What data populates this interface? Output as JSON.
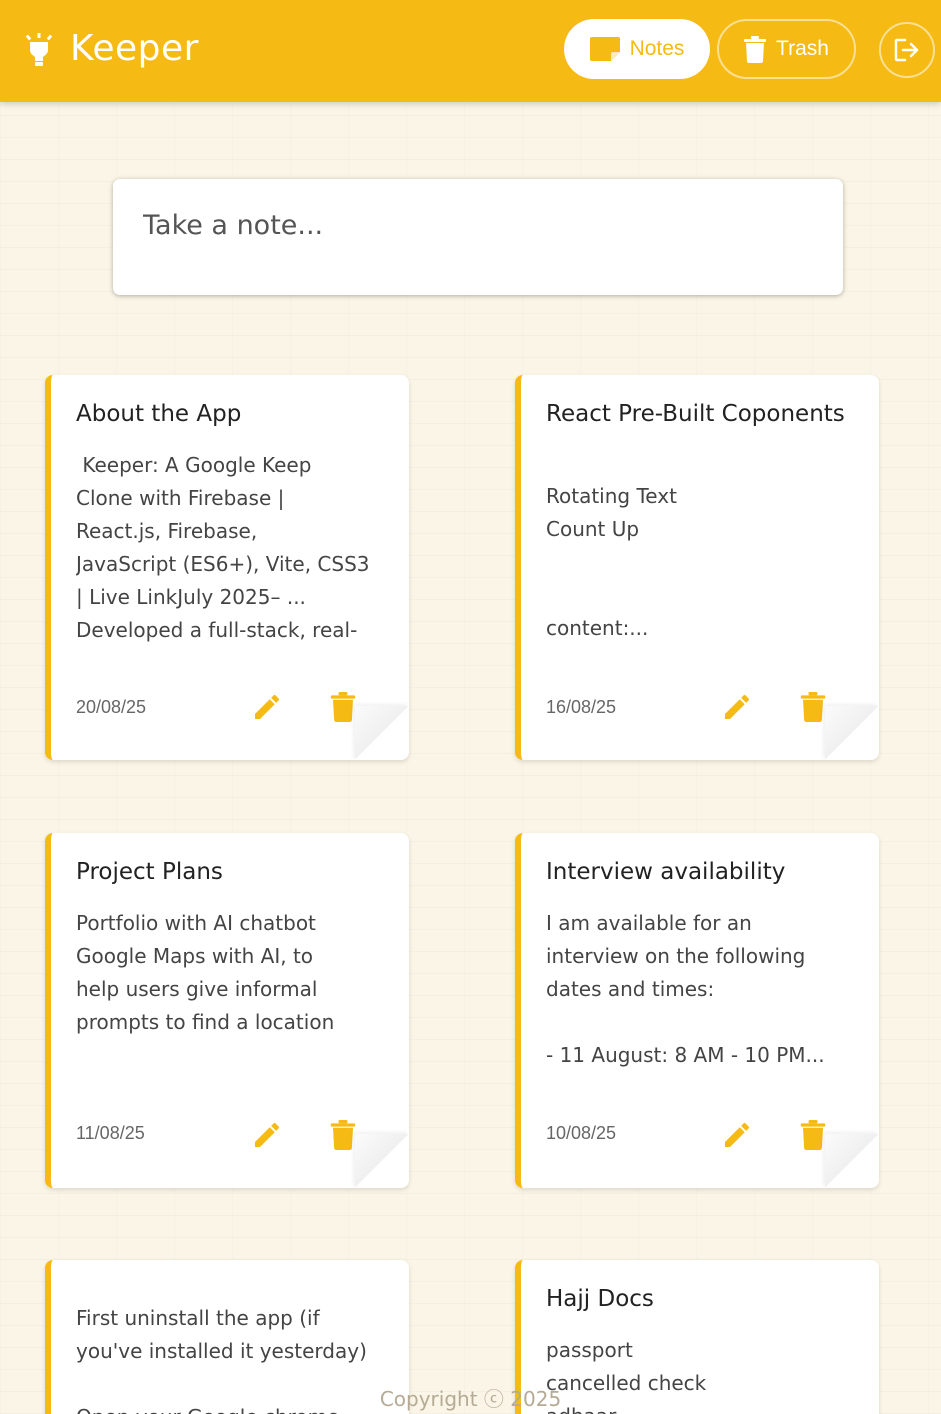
{
  "header": {
    "app_title": "Keeper",
    "brand_color": "#f5ba13",
    "nav": {
      "notes_label": "Notes",
      "trash_label": "Trash",
      "active": "Notes"
    }
  },
  "composer": {
    "placeholder": "Take a note..."
  },
  "notes": [
    {
      "title": "About the App",
      "content": " Keeper: A Google Keep\nClone with Firebase |\nReact.js, Firebase,\nJavaScript (ES6+), Vite, CSS3\n| Live LinkJuly 2025– ...\nDeveloped a full-stack, real-",
      "date": "20/08/25"
    },
    {
      "title": "React Pre-Built Coponents",
      "content": "Rotating Text\nCount Up\n\n\ncontent:...",
      "date": "16/08/25"
    },
    {
      "title": "Project Plans",
      "content": "Portfolio with AI chatbot\nGoogle Maps with AI, to\nhelp users give informal\nprompts to find a location",
      "date": "11/08/25"
    },
    {
      "title": "Interview availability",
      "content": "I am available for an\ninterview on the following\ndates and times:\n\n- 11 August: 8 AM - 10 PM...",
      "date": "10/08/25"
    },
    {
      "title": "",
      "content": "First uninstall the app (if\nyou've installed it yesterday)\n\nOpen your Google chrome",
      "date": ""
    },
    {
      "title": "Hajj Docs",
      "content": "passport\ncancelled check\nadhaar",
      "date": ""
    }
  ],
  "footer": {
    "copyright": "Copyright ⓒ 2025"
  },
  "icons": {
    "logo": "lightbulb-icon",
    "notes": "note-icon",
    "trash": "trash-icon",
    "logout": "logout-icon",
    "edit": "pencil-icon",
    "delete": "trash-icon"
  }
}
